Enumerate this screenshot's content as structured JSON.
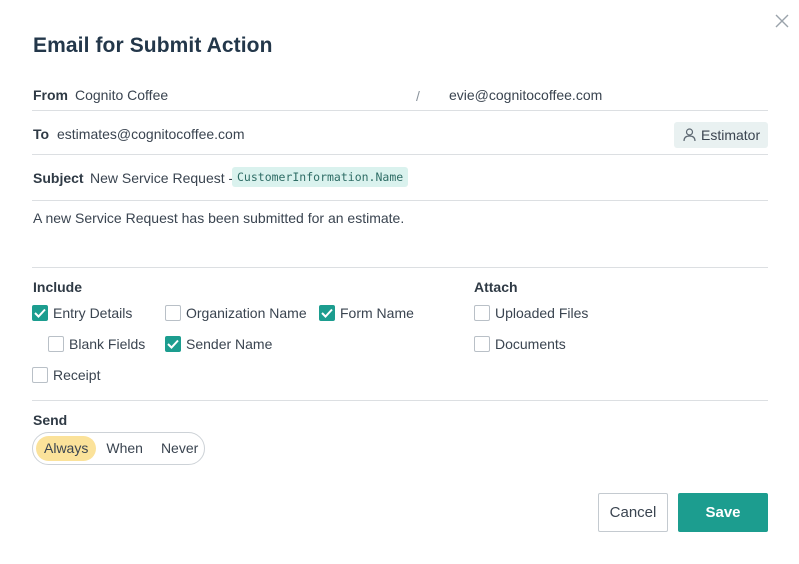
{
  "dialog": {
    "title": "Email for Submit Action",
    "close_icon": "close-icon"
  },
  "from": {
    "label": "From",
    "name": "Cognito Coffee",
    "separator": "/",
    "email": "evie@cognitocoffee.com"
  },
  "to": {
    "label": "To",
    "value": "estimates@cognitocoffee.com",
    "role_button": {
      "icon": "person-icon",
      "label": "Estimator"
    }
  },
  "subject": {
    "label": "Subject",
    "text": "New Service Request -",
    "token": "CustomerInformation.Name"
  },
  "body": {
    "text": "A new Service Request has been submitted for an estimate."
  },
  "include": {
    "label": "Include",
    "options": [
      {
        "label": "Entry Details",
        "checked": true
      },
      {
        "label": "Organization Name",
        "checked": false
      },
      {
        "label": "Form Name",
        "checked": true
      },
      {
        "label": "Blank Fields",
        "checked": false
      },
      {
        "label": "Sender Name",
        "checked": true
      },
      {
        "label": "Receipt",
        "checked": false
      }
    ]
  },
  "attach": {
    "label": "Attach",
    "options": [
      {
        "label": "Uploaded Files",
        "checked": false
      },
      {
        "label": "Documents",
        "checked": false
      }
    ]
  },
  "send": {
    "label": "Send",
    "options": [
      "Always",
      "When",
      "Never"
    ],
    "selected": "Always"
  },
  "actions": {
    "cancel_label": "Cancel",
    "save_label": "Save"
  },
  "colors": {
    "accent": "#1c9d8f",
    "selected_segment": "#fbe29a",
    "token_bg": "#daf2ee",
    "title": "#23374a"
  }
}
